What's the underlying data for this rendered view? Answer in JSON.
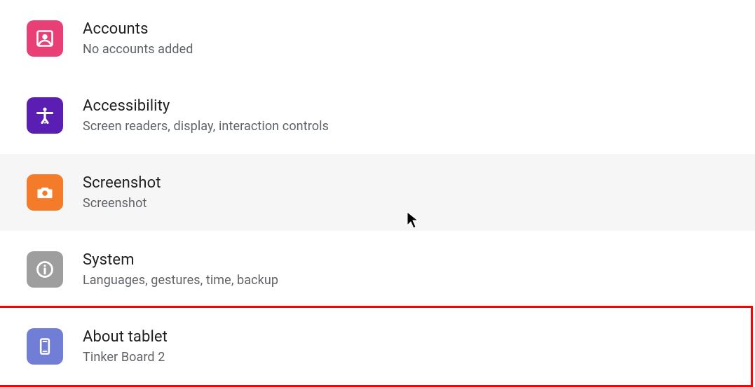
{
  "colors": {
    "accounts": "#e83f76",
    "accessibility": "#5b1eb2",
    "screenshot": "#f47b2a",
    "system": "#9e9e9e",
    "about": "#717ed6"
  },
  "settings": {
    "items": [
      {
        "key": "accounts",
        "title": "Accounts",
        "sub": "No accounts added"
      },
      {
        "key": "accessibility",
        "title": "Accessibility",
        "sub": "Screen readers, display, interaction controls"
      },
      {
        "key": "screenshot",
        "title": "Screenshot",
        "sub": "Screenshot"
      },
      {
        "key": "system",
        "title": "System",
        "sub": "Languages, gestures, time, backup"
      },
      {
        "key": "about",
        "title": "About tablet",
        "sub": "Tinker Board 2"
      }
    ]
  }
}
